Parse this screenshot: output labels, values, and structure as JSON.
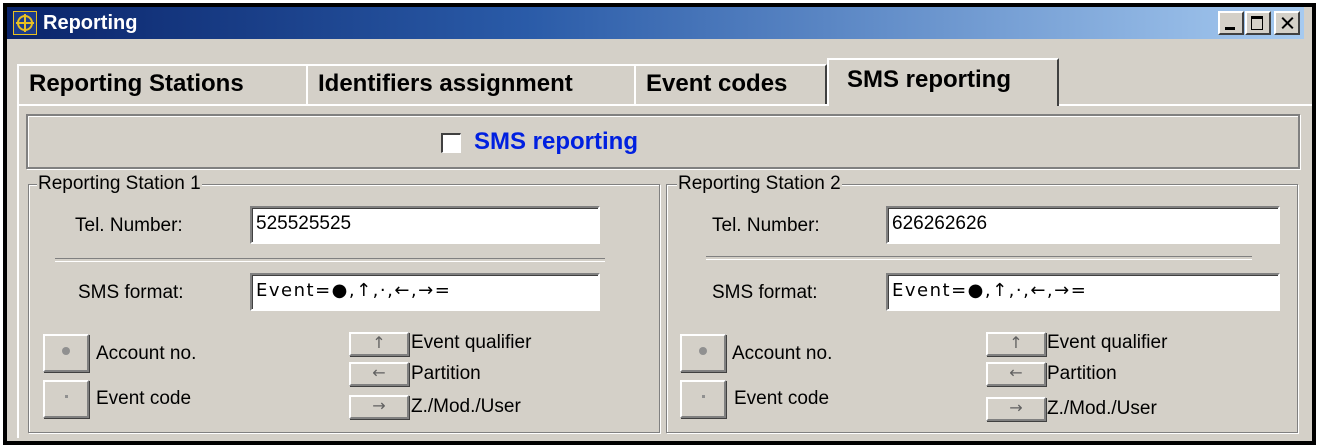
{
  "window": {
    "title": "Reporting",
    "icon": "app-icon",
    "controls": {
      "minimize": "minimize-icon",
      "maximize": "maximize-icon",
      "close": "close-icon"
    }
  },
  "tabs": [
    {
      "label": "Reporting Stations",
      "active": false
    },
    {
      "label": "Identifiers assignment",
      "active": false
    },
    {
      "label": "Event codes",
      "active": false
    },
    {
      "label": "SMS reporting",
      "active": true
    }
  ],
  "sms_reporting": {
    "label": "SMS reporting",
    "checked": false,
    "label_color": "#0020e0"
  },
  "stations": [
    {
      "title": "Reporting Station 1",
      "tel_label": "Tel. Number:",
      "tel_value": "525525525",
      "sms_label": "SMS format:",
      "sms_value": "Event=●,↑,·,←,→=",
      "buttons": [
        {
          "symbol": "●",
          "label": "Account no.",
          "icon": "dot-icon"
        },
        {
          "symbol": "·",
          "label": "Event code",
          "icon": "small-dot-icon"
        },
        {
          "symbol": "↑",
          "label": "Event qualifier",
          "icon": "arrow-up-icon"
        },
        {
          "symbol": "←",
          "label": "Partition",
          "icon": "arrow-left-icon"
        },
        {
          "symbol": "→",
          "label": "Z./Mod./User",
          "icon": "arrow-right-icon"
        }
      ]
    },
    {
      "title": "Reporting Station 2",
      "tel_label": "Tel. Number:",
      "tel_value": "626262626",
      "sms_label": "SMS format:",
      "sms_value": "Event=●,↑,·,←,→=",
      "buttons": [
        {
          "symbol": "●",
          "label": "Account no.",
          "icon": "dot-icon"
        },
        {
          "symbol": "·",
          "label": "Event code",
          "icon": "small-dot-icon"
        },
        {
          "symbol": "↑",
          "label": "Event qualifier",
          "icon": "arrow-up-icon"
        },
        {
          "symbol": "←",
          "label": "Partition",
          "icon": "arrow-left-icon"
        },
        {
          "symbol": "→",
          "label": "Z./Mod./User",
          "icon": "arrow-right-icon"
        }
      ]
    }
  ]
}
